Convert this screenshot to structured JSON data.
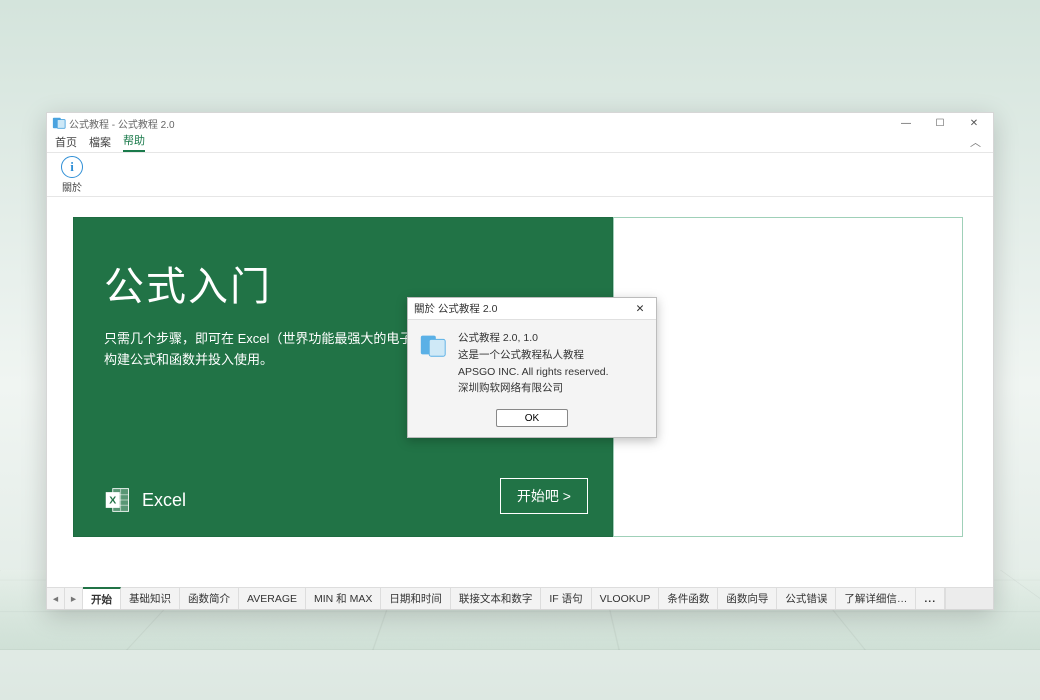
{
  "window": {
    "title": "公式教程 - 公式教程 2.0"
  },
  "menu": {
    "home": "首页",
    "file": "檔案",
    "help": "帮助"
  },
  "ribbon": {
    "about_label": "關於"
  },
  "hero": {
    "heading": "公式入门",
    "body_line1": "只需几个步骤，即可在 Excel（世界功能最强大的电子表…",
    "body_line2": "构建公式和函数并投入使用。",
    "brand": "Excel",
    "start": "开始吧 >"
  },
  "dialog": {
    "title": "關於 公式教程 2.0",
    "line1": "公式教程 2.0, 1.0",
    "line2": "这是一个公式教程私人教程",
    "line3": "APSGO INC. All rights reserved.",
    "line4": "深圳购软网络有限公司",
    "ok": "OK"
  },
  "tabs": {
    "items": [
      "开始",
      "基础知识",
      "函数简介",
      "AVERAGE",
      "MIN 和 MAX",
      "日期和时间",
      "联接文本和数字",
      "IF 语句",
      "VLOOKUP",
      "条件函数",
      "函数向导",
      "公式错误",
      "了解详细信…"
    ],
    "more": "..."
  }
}
